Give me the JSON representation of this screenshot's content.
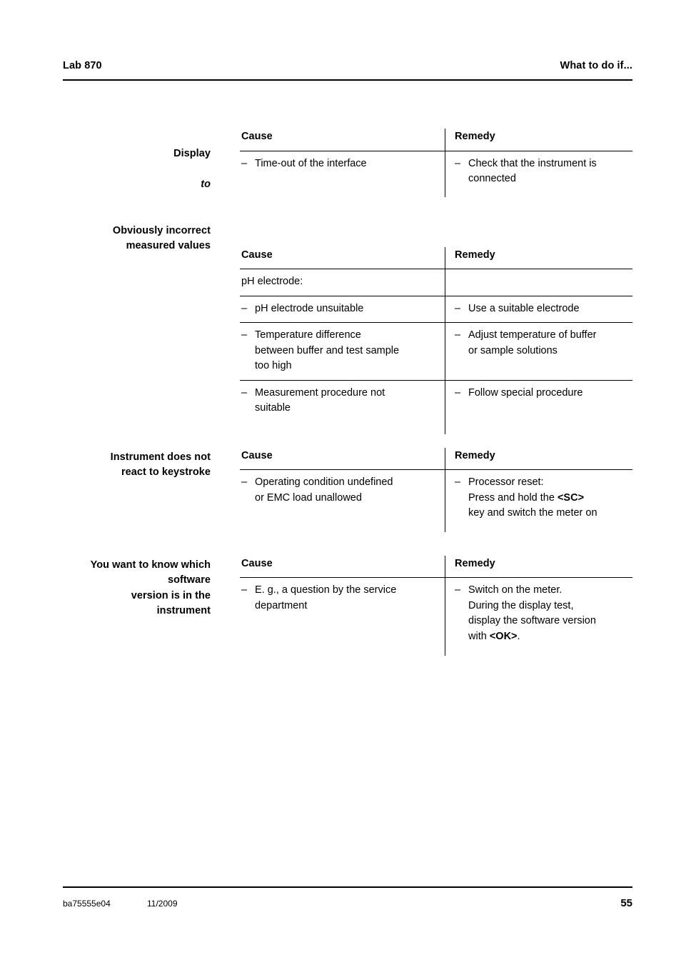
{
  "header": {
    "left": "Lab 870",
    "right": "What to do if..."
  },
  "columns": {
    "cause": "Cause",
    "remedy": "Remedy"
  },
  "bullet": "–",
  "blocks": [
    {
      "label_line1": "Display",
      "label_line2": "to",
      "rows": [
        {
          "cause": "Time-out of the interface",
          "remedy": "Check that the instrument is\nconnected"
        }
      ]
    },
    {
      "label": "Obviously incorrect\nmeasured values",
      "rows": [
        {
          "cause": "pH electrode:",
          "remedy": ""
        },
        {
          "cause": "pH electrode unsuitable",
          "remedy": "Use a suitable electrode"
        },
        {
          "cause": "Temperature difference\nbetween buffer and test sample\ntoo high",
          "remedy": "Adjust temperature of buffer\nor sample solutions"
        },
        {
          "cause": "Measurement procedure not\nsuitable",
          "remedy": "Follow special procedure"
        }
      ]
    },
    {
      "label": "Instrument does not\nreact to keystroke",
      "rows": [
        {
          "cause": "Operating condition undefined\nor EMC load unallowed",
          "remedy_pre": "Processor reset:\nPress and hold the ",
          "remedy_key": "<SC>",
          "remedy_post": "\nkey and switch the meter on"
        }
      ]
    },
    {
      "label": "You want to know which\nsoftware\nversion is in the\ninstrument",
      "rows": [
        {
          "cause": "E. g., a question by the service\ndepartment",
          "remedy_pre": "Switch on the meter.\nDuring the display test,\ndisplay the software version\nwith ",
          "remedy_key": "<OK>",
          "remedy_post": "."
        }
      ]
    }
  ],
  "footer": {
    "doc_code": "ba75555e04",
    "doc_date": "11/2009",
    "page_number": "55"
  }
}
